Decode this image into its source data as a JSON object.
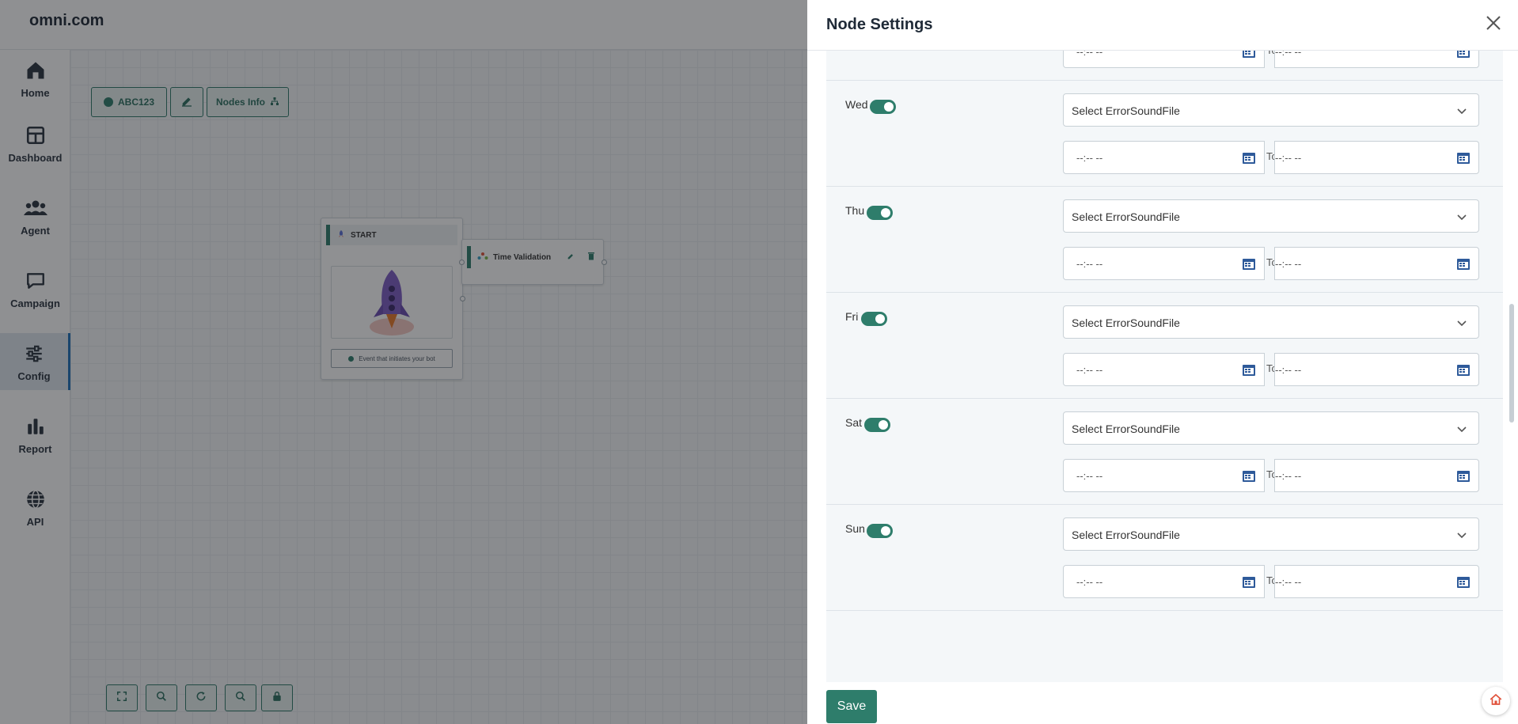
{
  "app": {
    "brand": "omni.com"
  },
  "sidebar": {
    "items": [
      {
        "label": "Home",
        "icon": "home-icon"
      },
      {
        "label": "Dashboard",
        "icon": "dashboard-icon"
      },
      {
        "label": "Agent",
        "icon": "agent-icon"
      },
      {
        "label": "Campaign",
        "icon": "campaign-icon"
      },
      {
        "label": "Config",
        "icon": "config-icon",
        "active": true
      },
      {
        "label": "Report",
        "icon": "report-icon"
      },
      {
        "label": "API",
        "icon": "api-icon"
      }
    ]
  },
  "toolbar": {
    "flow_name": "ABC123",
    "nodes_info_label": "Nodes Info"
  },
  "canvas": {
    "start_node": {
      "title": "START",
      "event_label": "Event that initiates your bot"
    },
    "time_node": {
      "title": "Time Validation"
    }
  },
  "drawer": {
    "title": "Node Settings",
    "save_label": "Save",
    "to_label": "To",
    "time_placeholder": "--:-- --",
    "select_placeholder": "Select ErrorSoundFile",
    "days": [
      {
        "label": "",
        "enabled": true
      },
      {
        "label": "Wed",
        "enabled": true
      },
      {
        "label": "Thu",
        "enabled": true
      },
      {
        "label": "Fri",
        "enabled": true
      },
      {
        "label": "Sat",
        "enabled": true
      },
      {
        "label": "Sun",
        "enabled": true
      }
    ]
  },
  "colors": {
    "accent": "#2e7d6b",
    "nav_active": "#1d6fb8",
    "overlay": "#14181c"
  }
}
